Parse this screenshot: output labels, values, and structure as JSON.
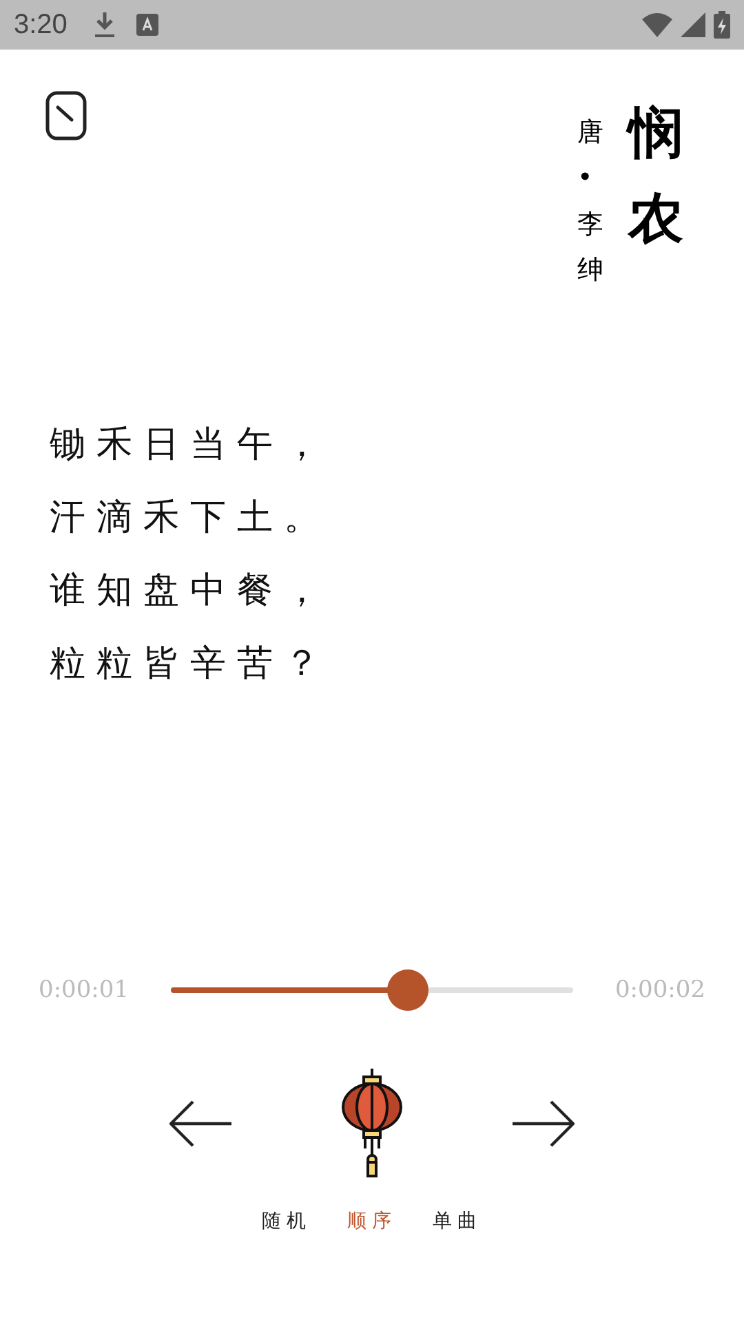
{
  "status_bar": {
    "time": "3:20"
  },
  "poem": {
    "title": "悯农",
    "author": "唐•李绅",
    "lines": [
      "锄禾日当午，",
      "汗滴禾下土。",
      "谁知盘中餐，",
      "粒粒皆辛苦？"
    ]
  },
  "player": {
    "elapsed": "0:00:01",
    "total": "0:00:02",
    "level": 0.59
  },
  "modes": [
    {
      "label": "随机",
      "selected": false
    },
    {
      "label": "顺序",
      "selected": true
    },
    {
      "label": "单曲",
      "selected": false
    }
  ]
}
